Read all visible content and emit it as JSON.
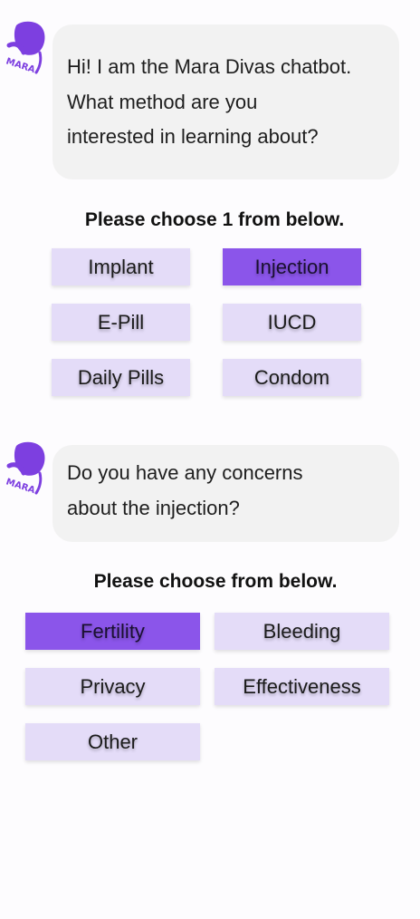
{
  "brand": {
    "accent": "#8b55ea",
    "option_bg": "#e4dcf8",
    "bubble_bg": "#f2f2f2"
  },
  "messages": [
    {
      "avatar_icon": "mara-logo-icon",
      "lines": [
        "Hi! I am the Mara Divas chatbot.",
        "What method are you",
        "interested in learning about?"
      ],
      "prompt": "Please choose 1 from below.",
      "options": [
        {
          "label": "Implant",
          "selected": false
        },
        {
          "label": "Injection",
          "selected": true
        },
        {
          "label": "E-Pill",
          "selected": false
        },
        {
          "label": "IUCD",
          "selected": false
        },
        {
          "label": "Daily Pills",
          "selected": false
        },
        {
          "label": "Condom",
          "selected": false
        }
      ]
    },
    {
      "avatar_icon": "mara-logo-icon",
      "lines": [
        "Do you have any concerns",
        "about the injection?"
      ],
      "prompt": "Please choose from below.",
      "options": [
        {
          "label": "Fertility",
          "selected": true
        },
        {
          "label": "Bleeding",
          "selected": false
        },
        {
          "label": "Privacy",
          "selected": false
        },
        {
          "label": "Effectiveness",
          "selected": false
        },
        {
          "label": "Other",
          "selected": false
        }
      ]
    }
  ]
}
